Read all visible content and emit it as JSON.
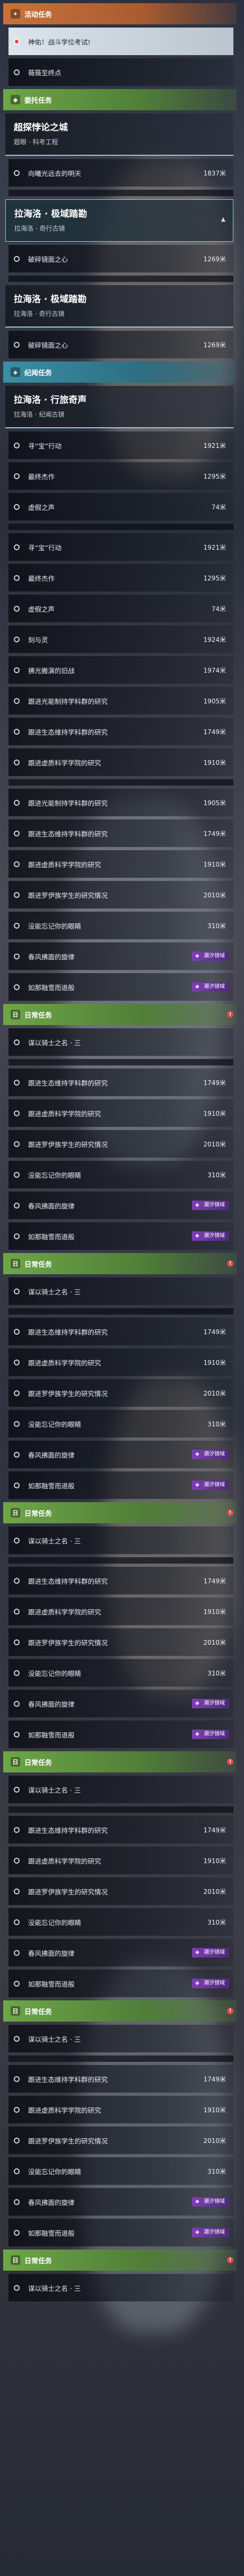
{
  "sections": [
    {
      "type": "category",
      "style": "orange",
      "icon": "✦",
      "label": "活动任务"
    },
    {
      "type": "row",
      "highlight": true,
      "track": true,
      "name": "神佑！战斗学位考试!",
      "dist": ""
    },
    {
      "type": "row",
      "name": "薇薇至终点",
      "dist": ""
    },
    {
      "type": "category",
      "style": "green",
      "icon": "◆",
      "label": "委托任务"
    },
    {
      "type": "header",
      "title": "超探悖论之城",
      "subtitle": "题眼 · 科考工程"
    },
    {
      "type": "row",
      "name": "向曦光远去的明天",
      "dist": "1837米"
    },
    {
      "type": "cut"
    },
    {
      "type": "header",
      "selected": true,
      "title": "拉海洛 · 极域踏勘",
      "subtitle": "拉海洛 · 奇行古镜"
    },
    {
      "type": "row",
      "name": "破碎镜面之心",
      "dist": "1269米"
    },
    {
      "type": "cut"
    },
    {
      "type": "header",
      "title": "拉海洛 · 极域踏勘",
      "subtitle": "拉海洛 · 奇行古镜"
    },
    {
      "type": "row",
      "name": "破碎镜面之心",
      "dist": "1269米"
    },
    {
      "type": "category",
      "style": "teal",
      "icon": "◈",
      "label": "纪闻任务"
    },
    {
      "type": "header",
      "title": "拉海洛 · 行旅奇声",
      "subtitle": "拉海洛 · 纪闻古镜"
    },
    {
      "type": "row",
      "name": "寻“宝”行动",
      "dist": "1921米"
    },
    {
      "type": "row",
      "name": "最终杰作",
      "dist": "1295米"
    },
    {
      "type": "row",
      "name": "虚假之声",
      "dist": "74米"
    },
    {
      "type": "cut"
    },
    {
      "type": "row",
      "name": "寻“宝”行动",
      "dist": "1921米"
    },
    {
      "type": "row",
      "name": "最终杰作",
      "dist": "1295米"
    },
    {
      "type": "row",
      "name": "虚假之声",
      "dist": "74米"
    },
    {
      "type": "row",
      "name": "刻与灵",
      "dist": "1924米"
    },
    {
      "type": "row",
      "name": "拂光搬演的旧战",
      "dist": "1974米"
    },
    {
      "type": "row",
      "name": "跟进光能制持学科群的研究",
      "dist": "1905米"
    },
    {
      "type": "row",
      "name": "跟进生态维持学科群的研究",
      "dist": "1749米"
    },
    {
      "type": "row",
      "name": "跟进虚质科学学院的研究",
      "dist": "1910米"
    },
    {
      "type": "cut"
    },
    {
      "type": "row",
      "name": "跟进光能制持学科群的研究",
      "dist": "1905米"
    },
    {
      "type": "row",
      "name": "跟进生态维持学科群的研究",
      "dist": "1749米"
    },
    {
      "type": "row",
      "name": "跟进虚质科学学院的研究",
      "dist": "1910米"
    },
    {
      "type": "row",
      "name": "跟进罗伊族学生的研究情况",
      "dist": "2010米"
    },
    {
      "type": "row",
      "name": "没能忘记你的眼睛",
      "dist": "310米"
    },
    {
      "type": "row",
      "name": "春风拂面的旋律",
      "dist": "",
      "badge": "潮汐镜域"
    },
    {
      "type": "row",
      "name": "如那融雪而退般",
      "dist": "",
      "badge": "潮汐镜域"
    },
    {
      "type": "category",
      "style": "green",
      "icon": "日",
      "label": "日常任务",
      "bell": true
    },
    {
      "type": "row",
      "name": "谋以骑士之名 · 三",
      "dist": ""
    },
    {
      "type": "cut"
    },
    {
      "type": "row",
      "name": "跟进生态维持学科群的研究",
      "dist": "1749米"
    },
    {
      "type": "row",
      "name": "跟进虚质科学学院的研究",
      "dist": "1910米"
    },
    {
      "type": "row",
      "name": "跟进罗伊族学生的研究情况",
      "dist": "2010米"
    },
    {
      "type": "row",
      "name": "没能忘记你的眼睛",
      "dist": "310米"
    },
    {
      "type": "row",
      "name": "春风拂面的旋律",
      "dist": "",
      "badge": "潮汐镜域"
    },
    {
      "type": "row",
      "name": "如那融雪而退般",
      "dist": "",
      "badge": "潮汐镜域"
    },
    {
      "type": "category",
      "style": "green",
      "icon": "日",
      "label": "日常任务",
      "bell": true
    },
    {
      "type": "row",
      "name": "谋以骑士之名 · 三",
      "dist": ""
    },
    {
      "type": "cut"
    },
    {
      "type": "row",
      "name": "跟进生态维持学科群的研究",
      "dist": "1749米"
    },
    {
      "type": "row",
      "name": "跟进虚质科学学院的研究",
      "dist": "1910米"
    },
    {
      "type": "row",
      "name": "跟进罗伊族学生的研究情况",
      "dist": "2010米"
    },
    {
      "type": "row",
      "name": "没能忘记你的眼睛",
      "dist": "310米"
    },
    {
      "type": "row",
      "name": "春风拂面的旋律",
      "dist": "",
      "badge": "潮汐镜域"
    },
    {
      "type": "row",
      "name": "如那融雪而退般",
      "dist": "",
      "badge": "潮汐镜域"
    },
    {
      "type": "category",
      "style": "green",
      "icon": "日",
      "label": "日常任务",
      "bell": true
    },
    {
      "type": "row",
      "name": "谋以骑士之名 · 三",
      "dist": ""
    },
    {
      "type": "cut"
    },
    {
      "type": "row",
      "name": "跟进生态维持学科群的研究",
      "dist": "1749米"
    },
    {
      "type": "row",
      "name": "跟进虚质科学学院的研究",
      "dist": "1910米"
    },
    {
      "type": "row",
      "name": "跟进罗伊族学生的研究情况",
      "dist": "2010米"
    },
    {
      "type": "row",
      "name": "没能忘记你的眼睛",
      "dist": "310米"
    },
    {
      "type": "row",
      "name": "春风拂面的旋律",
      "dist": "",
      "badge": "潮汐镜域"
    },
    {
      "type": "row",
      "name": "如那融雪而退般",
      "dist": "",
      "badge": "潮汐镜域"
    },
    {
      "type": "category",
      "style": "green",
      "icon": "日",
      "label": "日常任务",
      "bell": true
    },
    {
      "type": "row",
      "name": "谋以骑士之名 · 三",
      "dist": ""
    },
    {
      "type": "cut"
    },
    {
      "type": "row",
      "name": "跟进生态维持学科群的研究",
      "dist": "1749米"
    },
    {
      "type": "row",
      "name": "跟进虚质科学学院的研究",
      "dist": "1910米"
    },
    {
      "type": "row",
      "name": "跟进罗伊族学生的研究情况",
      "dist": "2010米"
    },
    {
      "type": "row",
      "name": "没能忘记你的眼睛",
      "dist": "310米"
    },
    {
      "type": "row",
      "name": "春风拂面的旋律",
      "dist": "",
      "badge": "潮汐镜域"
    },
    {
      "type": "row",
      "name": "如那融雪而退般",
      "dist": "",
      "badge": "潮汐镜域"
    },
    {
      "type": "category",
      "style": "green",
      "icon": "日",
      "label": "日常任务",
      "bell": true
    },
    {
      "type": "row",
      "name": "谋以骑士之名 · 三",
      "dist": ""
    },
    {
      "type": "cut"
    },
    {
      "type": "row",
      "name": "跟进生态维持学科群的研究",
      "dist": "1749米"
    },
    {
      "type": "row",
      "name": "跟进虚质科学学院的研究",
      "dist": "1910米"
    },
    {
      "type": "row",
      "name": "跟进罗伊族学生的研究情况",
      "dist": "2010米"
    },
    {
      "type": "row",
      "name": "没能忘记你的眼睛",
      "dist": "310米"
    },
    {
      "type": "row",
      "name": "春风拂面的旋律",
      "dist": "",
      "badge": "潮汐镜域"
    },
    {
      "type": "row",
      "name": "如那融雪而退般",
      "dist": "",
      "badge": "潮汐镜域"
    },
    {
      "type": "category",
      "style": "green",
      "icon": "日",
      "label": "日常任务",
      "bell": true
    },
    {
      "type": "row",
      "name": "谋以骑士之名 · 三",
      "dist": ""
    }
  ]
}
